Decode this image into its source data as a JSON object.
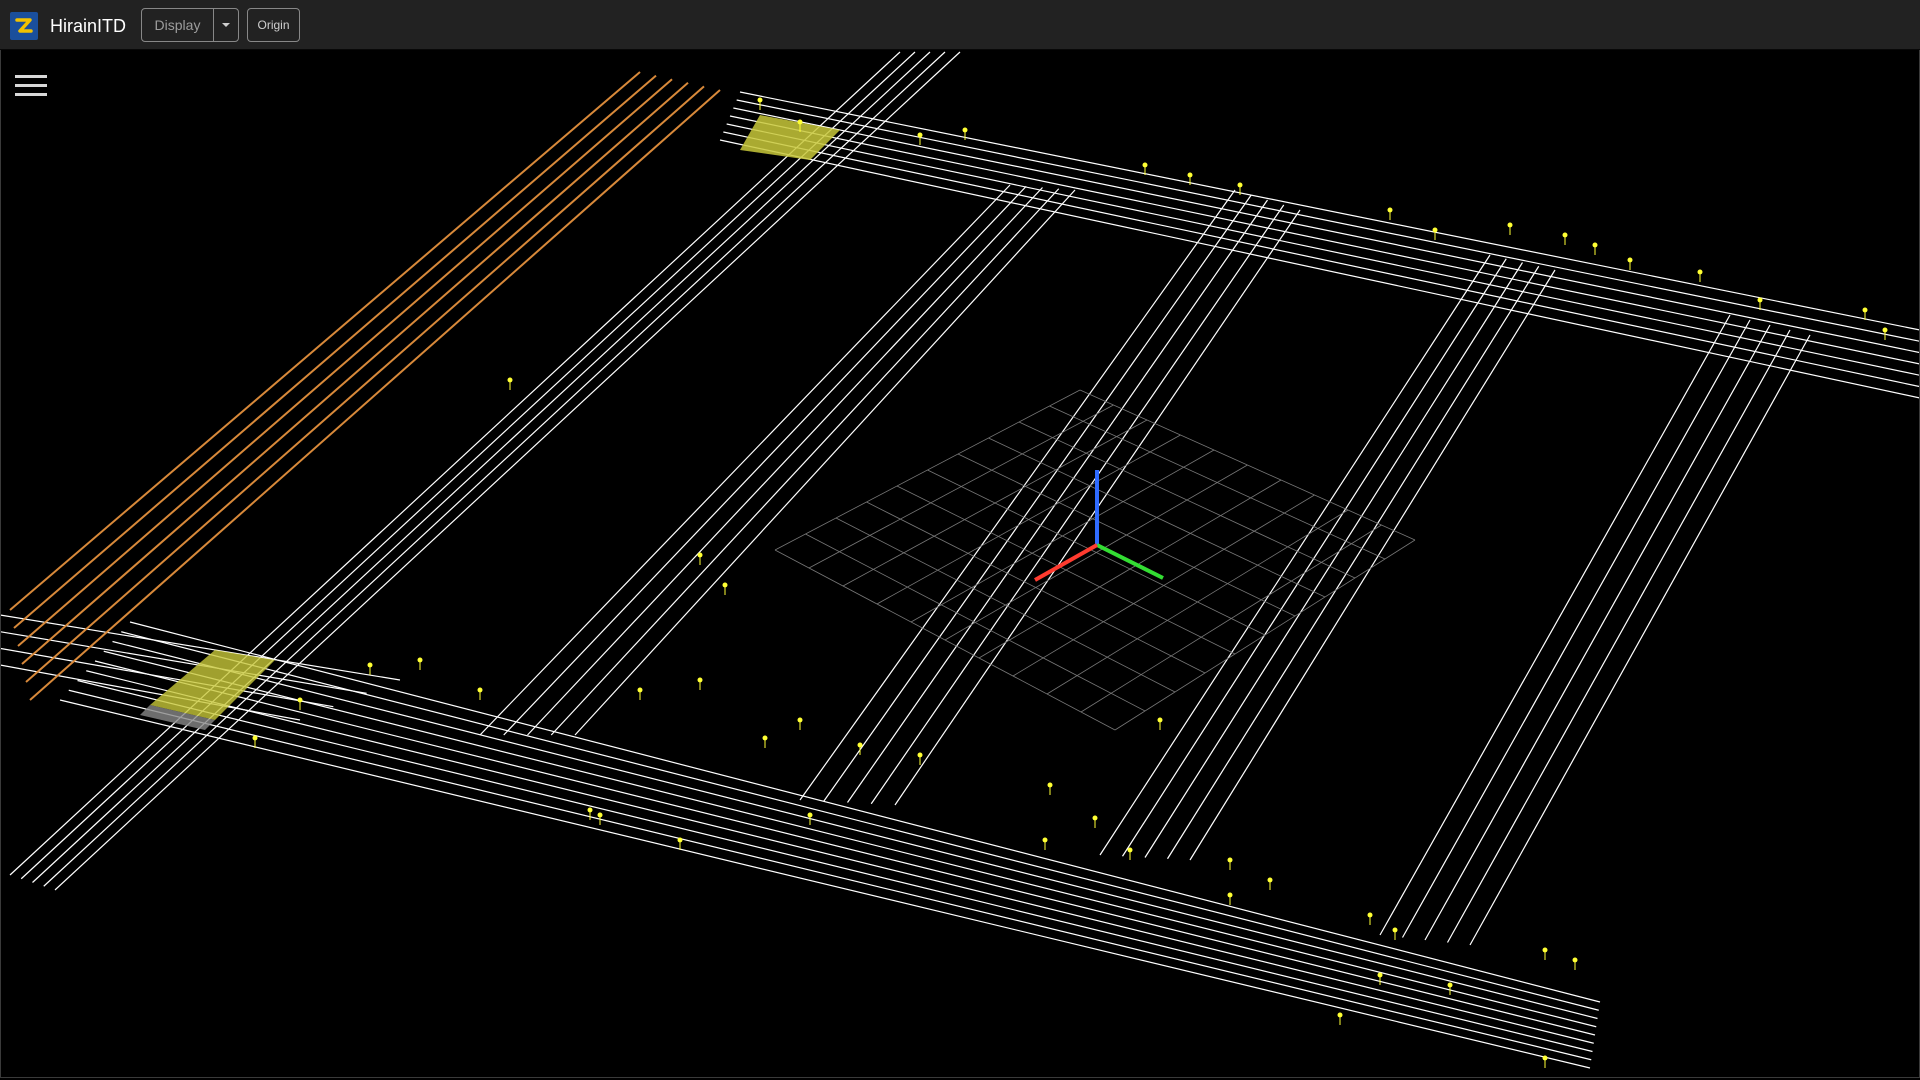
{
  "app": {
    "title": "HirainITD"
  },
  "toolbar": {
    "display_label": "Display",
    "origin_label": "Origin"
  },
  "icons": {
    "logo": "hirain-logo-icon",
    "menu": "hamburger-menu-icon",
    "caret": "caret-down-icon"
  },
  "colors": {
    "topbar": "#222222",
    "lane_line": "#ffffff",
    "highlight_lane": "#d8893a",
    "crosswalk": "#f2f246",
    "signal": "#ffff33",
    "axis_x": "#ff3b2f",
    "axis_y": "#33dd33",
    "axis_z": "#2f6bff"
  }
}
